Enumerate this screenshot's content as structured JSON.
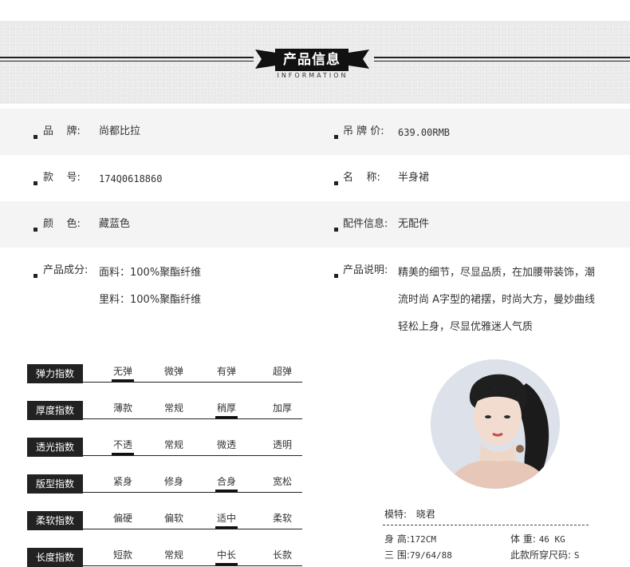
{
  "header": {
    "title": "产品信息",
    "subtitle": "INFORMATION"
  },
  "info": {
    "brand": {
      "label": "品    牌:",
      "value": "尚都比拉"
    },
    "price": {
      "label": "吊 牌 价:",
      "value": "639.00RMB"
    },
    "item_no": {
      "label": "款    号:",
      "value": "174Q0618860"
    },
    "name": {
      "label": "名    称:",
      "value": "半身裙"
    },
    "color": {
      "label": "颜    色:",
      "value": "藏蓝色"
    },
    "accessory": {
      "label": "配件信息:",
      "value": "无配件"
    },
    "composition": {
      "label": "产品成分:",
      "lines": [
        "面料：100%聚酯纤维",
        "里料：100%聚酯纤维"
      ]
    },
    "description": {
      "label": "产品说明:",
      "lines": [
        "精美的细节，尽显品质，在加腰带装饰，潮",
        "流时尚 A字型的裙摆，时尚大方，曼妙曲线",
        "轻松上身，尽显优雅迷人气质"
      ]
    }
  },
  "indices": [
    {
      "label": "弹力指数",
      "options": [
        "无弹",
        "微弹",
        "有弹",
        "超弹"
      ],
      "selected": 0
    },
    {
      "label": "厚度指数",
      "options": [
        "薄款",
        "常规",
        "稍厚",
        "加厚"
      ],
      "selected": 2
    },
    {
      "label": "透光指数",
      "options": [
        "不透",
        "常规",
        "微透",
        "透明"
      ],
      "selected": 0
    },
    {
      "label": "版型指数",
      "options": [
        "紧身",
        "修身",
        "合身",
        "宽松"
      ],
      "selected": 2
    },
    {
      "label": "柔软指数",
      "options": [
        "偏硬",
        "偏软",
        "适中",
        "柔软"
      ],
      "selected": 2
    },
    {
      "label": "长度指数",
      "options": [
        "短款",
        "常规",
        "中长",
        "长款"
      ],
      "selected": 2
    }
  ],
  "model": {
    "name_label": "模特:",
    "name": "晓君",
    "height_label": "身 高:",
    "height": "172CM",
    "weight_label": "体 重:",
    "weight": "46 KG",
    "measure_label": "三 围:",
    "measure": "79/64/88",
    "size_label": "此款所穿尺码:",
    "size": "S"
  },
  "colors": {
    "dark": "#222222",
    "band": "#f4f4f4",
    "avatar_bg": "#dde1ea"
  }
}
